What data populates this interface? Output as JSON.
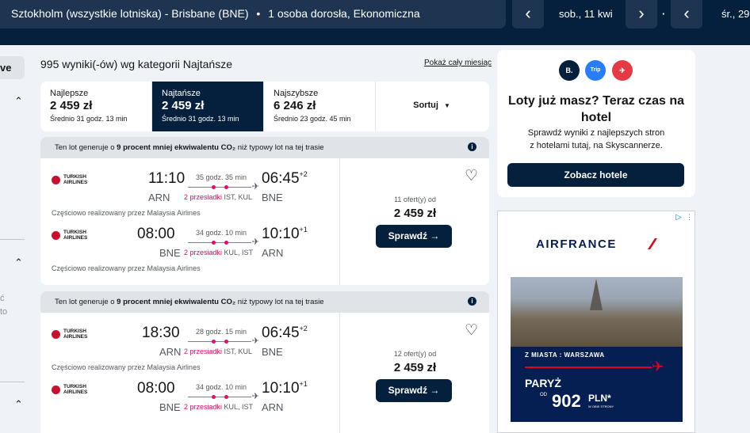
{
  "header": {
    "route": "Sztokholm (wszystkie lotniska) - Brisbane (BNE)",
    "separator": "•",
    "passengers": "1 osoba dorosła, Ekonomiczna",
    "depart_date": "sob., 11 kwi",
    "return_date": "śr., 29",
    "date_sep": "·"
  },
  "sidebar": {
    "button_label": "ve",
    "text1": "ć",
    "text2": "to"
  },
  "results": {
    "count_text": "995 wyniki(-ów) wg kategorii Najtańsze",
    "show_month": "Pokaż cały miesiąc"
  },
  "sort_tabs": [
    {
      "label": "Najlepsze",
      "price": "2 459 zł",
      "duration": "Średnio 31 godz. 13 min"
    },
    {
      "label": "Najtańsze",
      "price": "2 459 zł",
      "duration": "Średnio 31 godz. 13 min"
    },
    {
      "label": "Najszybsze",
      "price": "6 246 zł",
      "duration": "Średnio 23 godz. 45 min"
    }
  ],
  "sort_button": "Sortuj",
  "eco_banner": {
    "pre": "Ten lot generuje o ",
    "bold": "9 procent mniej ekwiwalentu CO₂",
    "post": " niż typowy lot na tej trasie"
  },
  "airline": {
    "line1": "TURKISH",
    "line2": "AIRLINES"
  },
  "cards": [
    {
      "outbound": {
        "dep_time": "11:10",
        "arr_time": "06:45",
        "arr_offset": "+2",
        "dep_code": "ARN",
        "arr_code": "BNE",
        "duration": "35 godz. 35 min",
        "stops": "2 przesiadki",
        "via": "IST, KUL"
      },
      "inbound": {
        "dep_time": "08:00",
        "arr_time": "10:10",
        "arr_offset": "+1",
        "dep_code": "BNE",
        "arr_code": "ARN",
        "duration": "34 godz. 10 min",
        "stops": "2 przesiadki",
        "via": "KUL, IST"
      },
      "operated": "Częściowo realizowany przez Malaysia Airlines",
      "offers": "11 ofert(y) od",
      "price": "2 459 zł",
      "button": "Sprawdź →"
    },
    {
      "outbound": {
        "dep_time": "18:30",
        "arr_time": "06:45",
        "arr_offset": "+2",
        "dep_code": "ARN",
        "arr_code": "BNE",
        "duration": "28 godz. 15 min",
        "stops": "2 przesiadki",
        "via": "IST, KUL"
      },
      "inbound": {
        "dep_time": "08:00",
        "arr_time": "10:10",
        "arr_offset": "+1",
        "dep_code": "BNE",
        "arr_code": "ARN",
        "duration": "34 godz. 10 min",
        "stops": "2 przesiadki",
        "via": "KUL, IST"
      },
      "operated": "Częściowo realizowany przez Malaysia Airlines",
      "offers": "12 ofert(y) od",
      "price": "2 459 zł",
      "button": "Sprawdź →"
    }
  ],
  "hotel": {
    "partners": [
      "B.",
      "Trip",
      "✈"
    ],
    "title": "Loty już masz? Teraz czas na hotel",
    "subtitle_1": "Sprawdź wyniki z najlepszych stron",
    "subtitle_2": "z hotelami tutaj, na Skyscannerze.",
    "button": "Zobacz hotele"
  },
  "ad": {
    "brand": "AIRFRANCE",
    "from_label": "Z MIASTA : WARSZAWA",
    "city": "PARYŻ",
    "od": "OD",
    "price": "902",
    "currency": "PLN*",
    "note": "W OBIE STRONY"
  },
  "colors": {
    "navy": "#05203c",
    "accent_pink": "#e70866",
    "turkish_red": "#c8102e",
    "af_blue": "#051f52",
    "af_red": "#e3001b"
  }
}
